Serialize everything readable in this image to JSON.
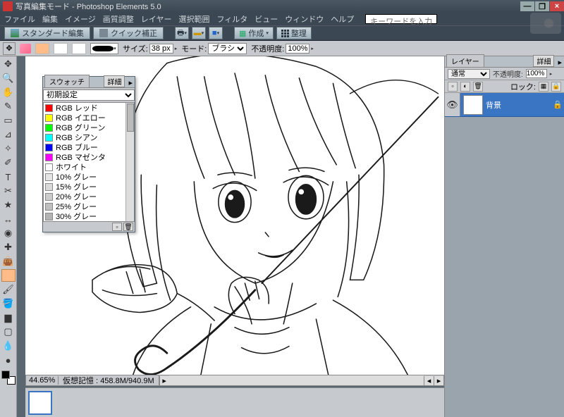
{
  "titlebar": {
    "text": "写真編集モード - Photoshop Elements 5.0"
  },
  "menu": {
    "items": [
      "ファイル",
      "編集",
      "イメージ",
      "画質調整",
      "レイヤー",
      "選択範囲",
      "フィルタ",
      "ビュー",
      "ウィンドウ",
      "ヘルプ"
    ],
    "search_placeholder": "キーワードを入力"
  },
  "toolbar": {
    "tabs": [
      "スタンダード編集",
      "クイック補正"
    ],
    "create": "作成",
    "organize": "整理"
  },
  "options": {
    "size_label": "サイズ:",
    "size_value": "38 px",
    "mode_label": "モード:",
    "mode_value": "ブラシ",
    "opacity_label": "不透明度:",
    "opacity_value": "100%"
  },
  "swatches": {
    "tab": "スウォッチ",
    "more": "詳細",
    "preset": "初期設定",
    "items": [
      {
        "label": "RGB レッド",
        "color": "#ff0000"
      },
      {
        "label": "RGB イエロー",
        "color": "#ffff00"
      },
      {
        "label": "RGB グリーン",
        "color": "#00ff00"
      },
      {
        "label": "RGB シアン",
        "color": "#00ffff"
      },
      {
        "label": "RGB ブルー",
        "color": "#0000ff"
      },
      {
        "label": "RGB マゼンタ",
        "color": "#ff00ff"
      },
      {
        "label": "ホワイト",
        "color": "#ffffff"
      },
      {
        "label": "10% グレー",
        "color": "#e5e5e5"
      },
      {
        "label": "15% グレー",
        "color": "#d9d9d9"
      },
      {
        "label": "20% グレー",
        "color": "#cccccc"
      },
      {
        "label": "25% グレー",
        "color": "#bfbfbf"
      },
      {
        "label": "30% グレー",
        "color": "#b3b3b3"
      }
    ]
  },
  "layers_panel": {
    "tab": "レイヤー",
    "more": "詳細",
    "blend": "通常",
    "opacity_label": "不透明度:",
    "opacity_value": "100%",
    "lock_label": "ロック:",
    "layer_name": "背景"
  },
  "status": {
    "zoom": "44.65%",
    "memory_label": "仮想記憶 :",
    "memory_value": "458.8M/940.9M"
  }
}
